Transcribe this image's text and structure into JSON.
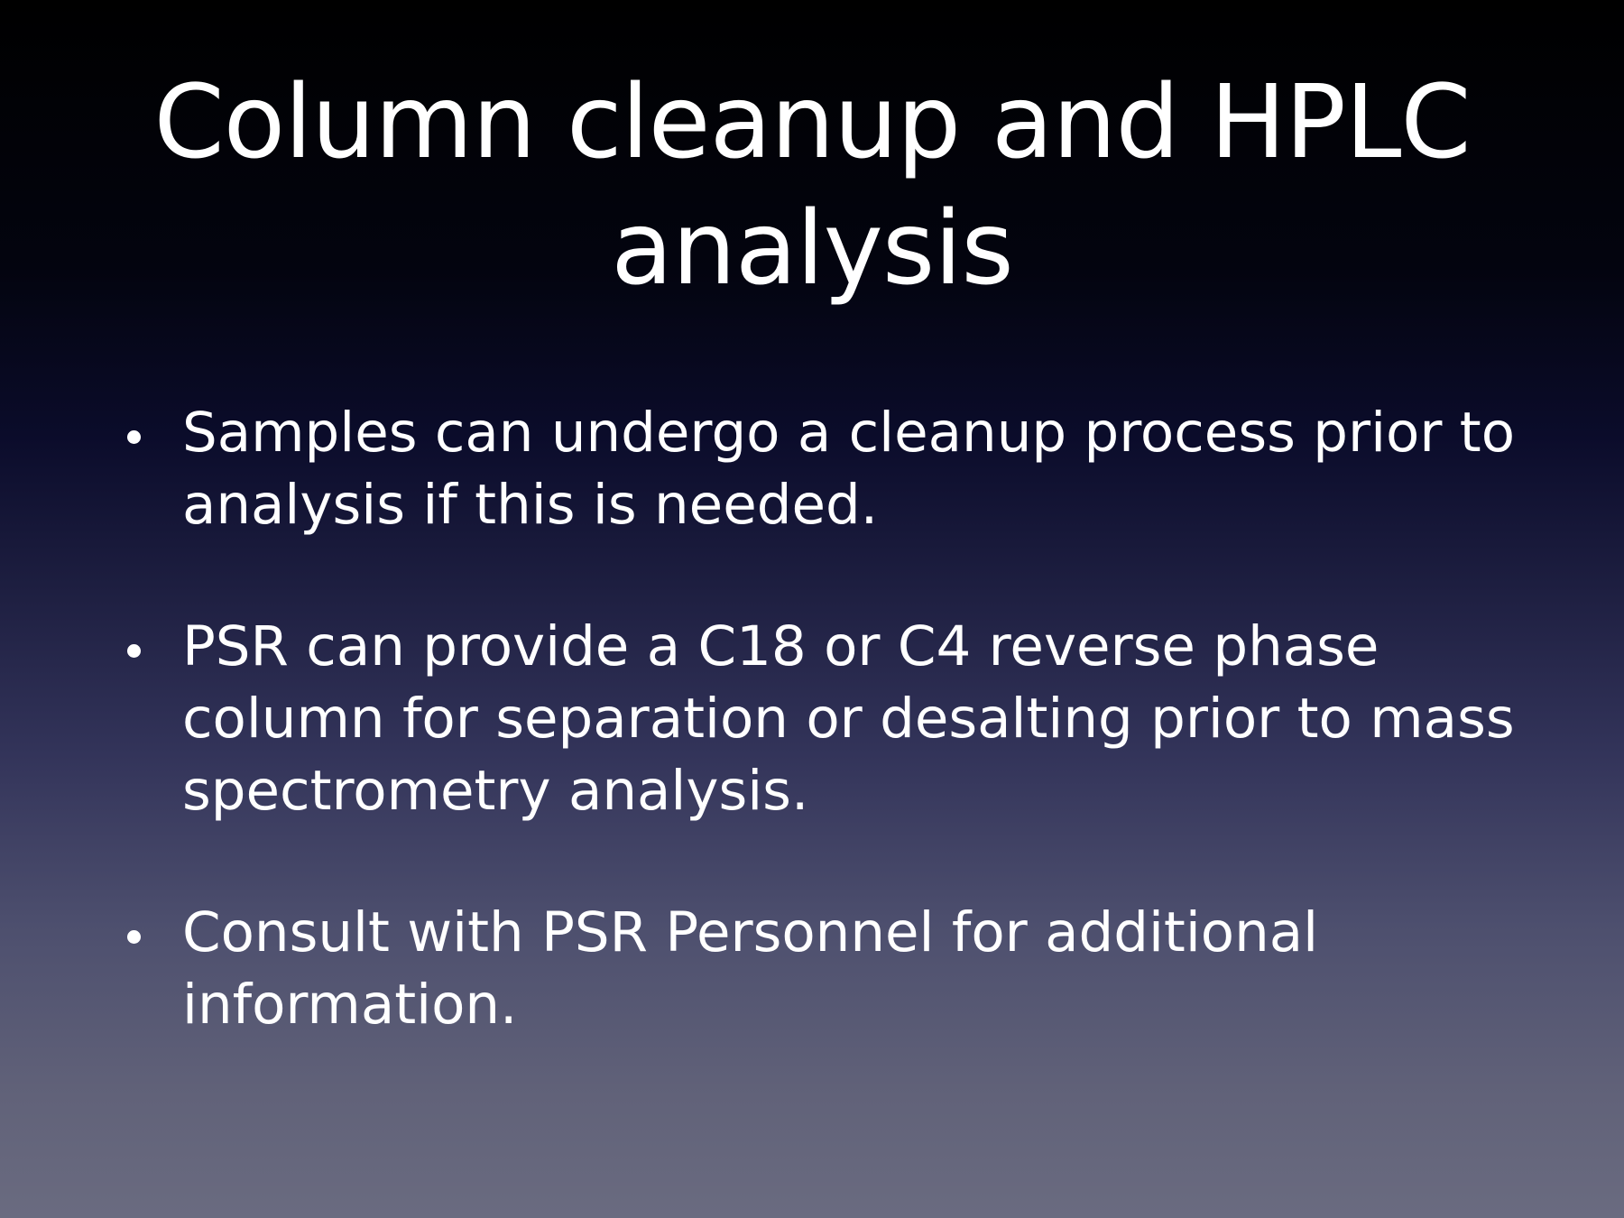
{
  "slide": {
    "title": "Column cleanup and HPLC analysis",
    "bullets": [
      "Samples can undergo a cleanup process prior to analysis if this is needed.",
      "PSR can provide a C18 or C4 reverse phase column for separation or desalting prior to mass spectrometry analysis.",
      "Consult with PSR Personnel for additional information."
    ]
  },
  "colors": {
    "background_top": "#000000",
    "background_bottom": "#6a6b80",
    "text": "#ffffff"
  }
}
